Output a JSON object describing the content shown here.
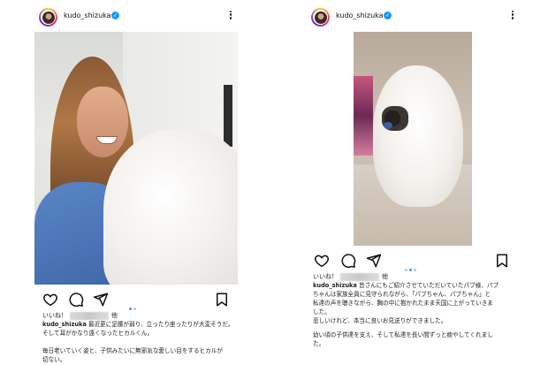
{
  "left_post": {
    "username": "kudo_shizuka",
    "likes_prefix": "いいね！",
    "likes_suffix": "他",
    "caption_user": "kudo_shizuka",
    "caption_lines": [
      "最近更に足腰が弱り、立ったり座ったりが大変そうだ。",
      "そして耳がかなり遠くなったヒカルくん。"
    ],
    "caption_lines_2": [
      "毎日老いていく姿と、子供みたいに無邪気な愛しい目をするヒカルが",
      "切ない。"
    ],
    "carousel_active": 0,
    "carousel_count": 2
  },
  "right_post": {
    "username": "kudo_shizuka",
    "likes_prefix": "いいね！",
    "likes_suffix": "他",
    "caption_user": "kudo_shizuka",
    "caption_lines": [
      "皆さんにもご紹介させていただいていたパブ様、パブ",
      "ちゃんは家族全員に見守られながら、「パブちゃん、パブちゃん」と",
      "私達の声を聴きながら、胸の中に抱かれたまま天国に上がっていきま",
      "した。",
      "悲しいけれど、本当に良いお見送りができました。"
    ],
    "caption_lines_2": [
      "幼い頃の子供達を支え、そして私達を長い間ずっと癒やしてくれまし",
      "た。"
    ],
    "carousel_active": 1,
    "carousel_count": 3
  },
  "colors": {
    "verified": "#1d9bf0",
    "carousel_active": "#3897f0",
    "carousel_inactive": "#c5c5c5"
  },
  "icons": {
    "like": "heart-icon",
    "comment": "comment-icon",
    "share": "send-icon",
    "save": "bookmark-icon",
    "verified": "verified-badge-icon",
    "more": "more-options-icon"
  }
}
